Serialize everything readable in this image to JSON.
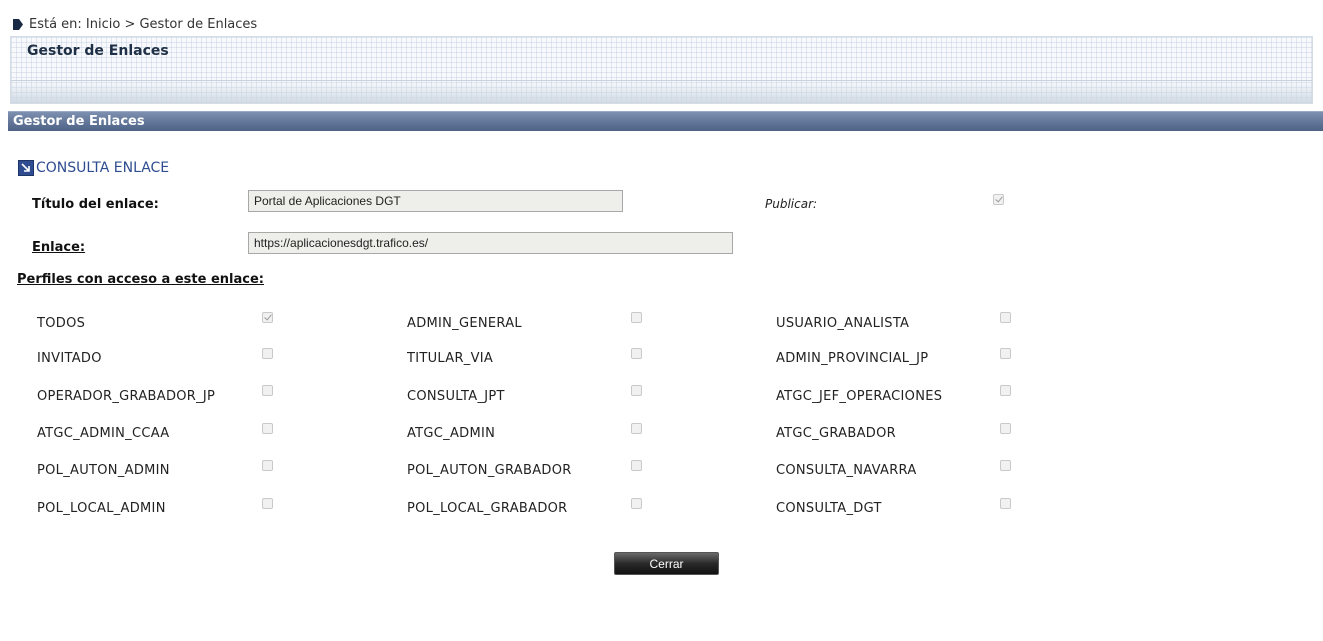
{
  "breadcrumb": {
    "text": "Está en: Inicio > Gestor de Enlaces"
  },
  "header": {
    "title": "Gestor de Enlaces"
  },
  "section": {
    "title": "Gestor de Enlaces"
  },
  "form": {
    "heading": "CONSULTA ENLACE",
    "titulo_label": "Título del enlace:",
    "titulo_value": "Portal de Aplicaciones DGT",
    "publicar_label": "Publicar:",
    "publicar_checked": true,
    "enlace_label": "Enlace:",
    "enlace_value": "https://aplicacionesdgt.trafico.es/",
    "perfiles_label": "Perfiles con acceso a este enlace:"
  },
  "profiles": [
    {
      "name": "TODOS",
      "checked": true
    },
    {
      "name": "ADMIN_GENERAL",
      "checked": false
    },
    {
      "name": "USUARIO_ANALISTA",
      "checked": false
    },
    {
      "name": "INVITADO",
      "checked": false
    },
    {
      "name": "TITULAR_VIA",
      "checked": false
    },
    {
      "name": "ADMIN_PROVINCIAL_JP",
      "checked": false
    },
    {
      "name": "OPERADOR_GRABADOR_JP",
      "checked": false
    },
    {
      "name": "CONSULTA_JPT",
      "checked": false
    },
    {
      "name": "ATGC_JEF_OPERACIONES",
      "checked": false
    },
    {
      "name": "ATGC_ADMIN_CCAA",
      "checked": false
    },
    {
      "name": "ATGC_ADMIN",
      "checked": false
    },
    {
      "name": "ATGC_GRABADOR",
      "checked": false
    },
    {
      "name": "POL_AUTON_ADMIN",
      "checked": false
    },
    {
      "name": "POL_AUTON_GRABADOR",
      "checked": false
    },
    {
      "name": "CONSULTA_NAVARRA",
      "checked": false
    },
    {
      "name": "POL_LOCAL_ADMIN",
      "checked": false
    },
    {
      "name": "POL_LOCAL_GRABADOR",
      "checked": false
    },
    {
      "name": "CONSULTA_DGT",
      "checked": false
    }
  ],
  "buttons": {
    "cerrar": "Cerrar"
  }
}
